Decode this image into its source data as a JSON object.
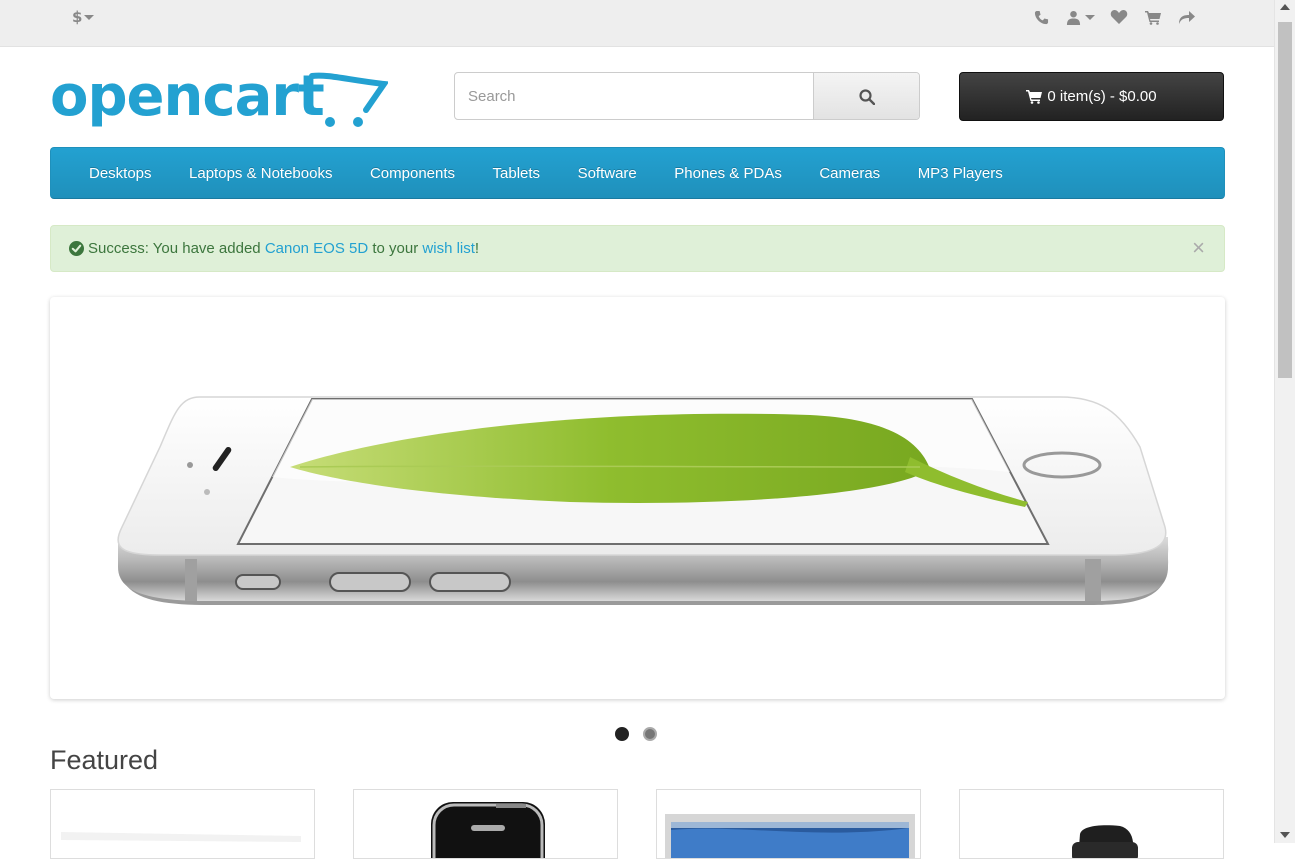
{
  "topbar": {
    "currency_symbol": "$",
    "icons": [
      "phone-icon",
      "user-icon",
      "heart-icon",
      "shopping-cart-icon",
      "share-icon"
    ]
  },
  "header": {
    "logo_text": "opencart",
    "search": {
      "placeholder": "Search",
      "value": ""
    },
    "cart_label": "0 item(s) - $0.00"
  },
  "menu": {
    "items": [
      "Desktops",
      "Laptops & Notebooks",
      "Components",
      "Tablets",
      "Software",
      "Phones & PDAs",
      "Cameras",
      "MP3 Players"
    ]
  },
  "alert": {
    "prefix": "Success: You have added ",
    "product_link": "Canon EOS 5D",
    "middle": " to your ",
    "wishlist_link": "wish list",
    "suffix": "!",
    "close": "×"
  },
  "slideshow": {
    "active_index": 0,
    "slide_count": 2
  },
  "featured": {
    "title": "Featured"
  },
  "colors": {
    "brand_blue": "#23a1d1",
    "success_bg": "#dff0d8",
    "success_text": "#3c763d",
    "cart_dark": "#333333"
  }
}
